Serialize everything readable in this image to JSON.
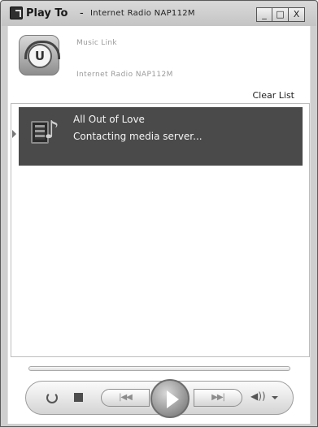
{
  "window": {
    "title": "Play To",
    "title_separator": "-",
    "device": "Internet Radio NAP112M",
    "controls": {
      "minimize": "_",
      "maximize": "□",
      "close": "X"
    }
  },
  "device_info": {
    "logo_letter": "U",
    "name": "Music Link",
    "model": "Internet Radio NAP112M"
  },
  "toolbar": {
    "clear_list": "Clear List"
  },
  "playlist": {
    "items": [
      {
        "title": "All Out of Love",
        "status": "Contacting media server..."
      }
    ]
  },
  "player": {
    "progress": 0,
    "prev_label": "|◀◀",
    "next_label": "▶▶|",
    "volume_label": "◀))"
  },
  "icons": [
    "app-icon",
    "music-link-logo-icon",
    "media-icon",
    "repeat-icon",
    "stop-icon",
    "previous-icon",
    "play-icon",
    "next-icon",
    "volume-icon",
    "chevron-down-icon"
  ]
}
